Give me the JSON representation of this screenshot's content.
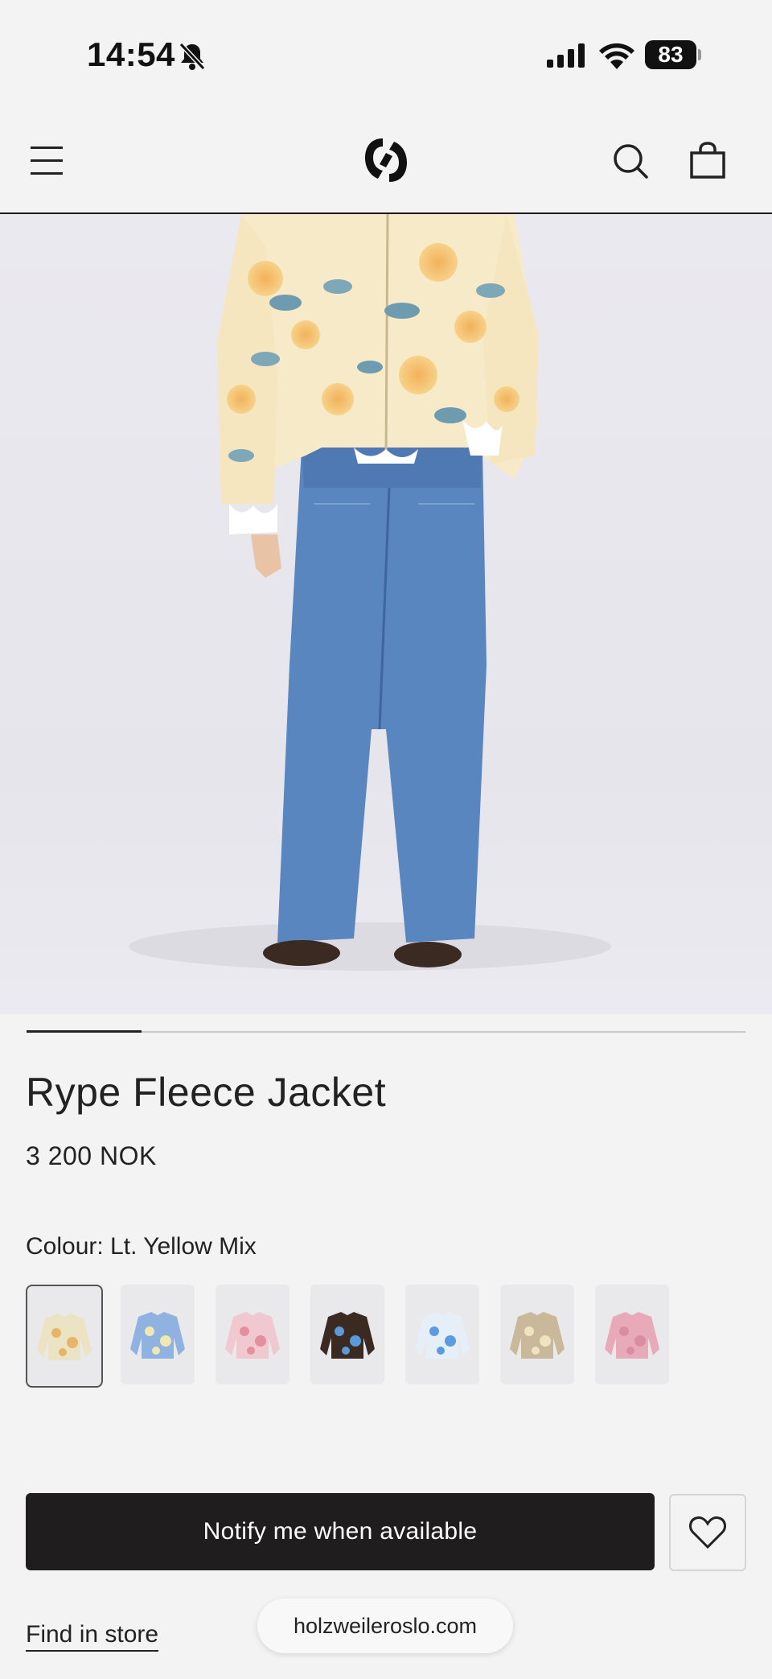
{
  "status_bar": {
    "time": "14:54",
    "battery": "83",
    "icons": [
      "bell-slash-icon",
      "cellular-signal-icon",
      "wifi-icon",
      "battery-icon"
    ]
  },
  "header": {
    "icons": [
      "hamburger-menu-icon",
      "brand-logo",
      "search-icon",
      "shopping-bag-icon"
    ]
  },
  "gallery": {
    "progress_fraction": 0.16
  },
  "product": {
    "title": "Rype Fleece Jacket",
    "price": "3 200 NOK",
    "colour_label": "Colour: Lt. Yellow Mix",
    "swatches": [
      {
        "colour": "#ece3c4",
        "accent": "#e6b56a",
        "selected": true
      },
      {
        "colour": "#8fb2e0",
        "accent": "#f0e7b2",
        "selected": false
      },
      {
        "colour": "#f0c8d0",
        "accent": "#e48ea0",
        "selected": false
      },
      {
        "colour": "#3a2a22",
        "accent": "#5a9ad8",
        "selected": false
      },
      {
        "colour": "#e6eef8",
        "accent": "#5d9ae0",
        "selected": false
      },
      {
        "colour": "#c9b99a",
        "accent": "#efe3c0",
        "selected": false
      },
      {
        "colour": "#e8a9b8",
        "accent": "#d88ea0",
        "selected": false
      }
    ]
  },
  "actions": {
    "notify_label": "Notify me when available",
    "find_in_store_label": "Find in store"
  },
  "browser": {
    "url": "holzweileroslo.com"
  }
}
